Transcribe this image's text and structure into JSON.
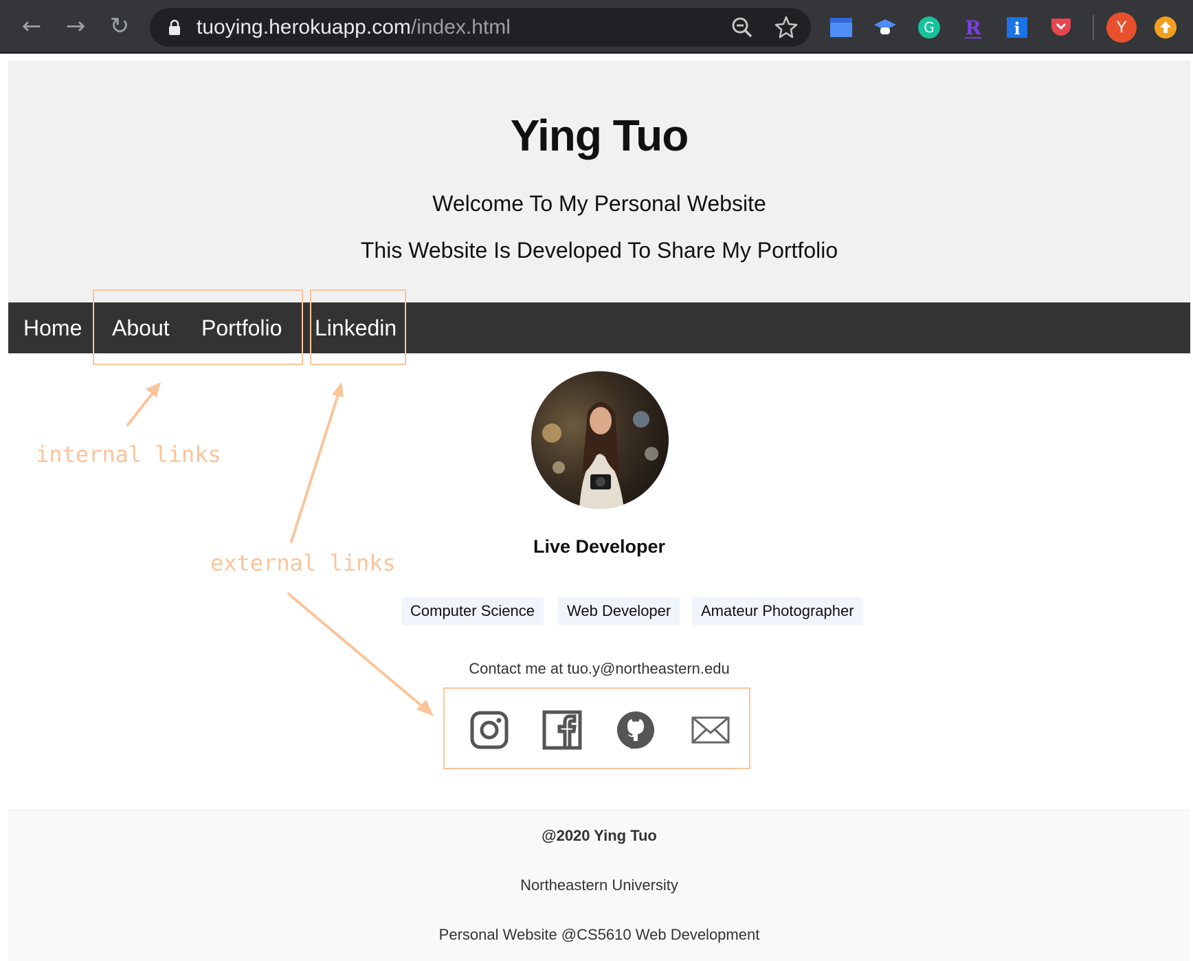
{
  "browser": {
    "url_host": "tuoying.herokuapp.com",
    "url_path": "/index.html",
    "profile_initial": "Y",
    "back_icon": "arrow-left-icon",
    "forward_icon": "arrow-right-icon",
    "reload_icon": "reload-icon",
    "zoom_icon": "zoom-icon",
    "bookmark_icon": "star-icon",
    "extensions": [
      "calendar-extension-icon",
      "graduation-cap-extension-icon",
      "grammarly-extension-icon",
      "r-extension-icon",
      "info-extension-icon",
      "pocket-extension-icon"
    ],
    "update_icon": "update-arrow-icon"
  },
  "hero": {
    "title": "Ying Tuo",
    "welcome": "Welcome To My Personal Website",
    "tagline": "This Website Is Developed To Share My Portfolio"
  },
  "nav": {
    "items": [
      {
        "label": "Home"
      },
      {
        "label": "About"
      },
      {
        "label": "Portfolio"
      },
      {
        "label": "Linkedin"
      }
    ]
  },
  "profile": {
    "name": "Live Developer",
    "tags": [
      "Computer Science",
      "Web Developer",
      "Amateur Photographer"
    ],
    "contact": "Contact me at tuo.y@northeastern.edu",
    "social_icons": [
      "instagram-icon",
      "facebook-icon",
      "github-icon",
      "mail-icon"
    ]
  },
  "footer": {
    "copyright": "@2020 Ying Tuo",
    "university": "Northeastern University",
    "course": "Personal Website @CS5610 Web Development"
  },
  "annotations": {
    "internal": "internal links",
    "external": "external links"
  },
  "colors": {
    "annotation": "#fbc49a",
    "navbar": "#333333",
    "hero_bg": "#f1f1f1",
    "tag_bg": "#f0f5fb"
  }
}
